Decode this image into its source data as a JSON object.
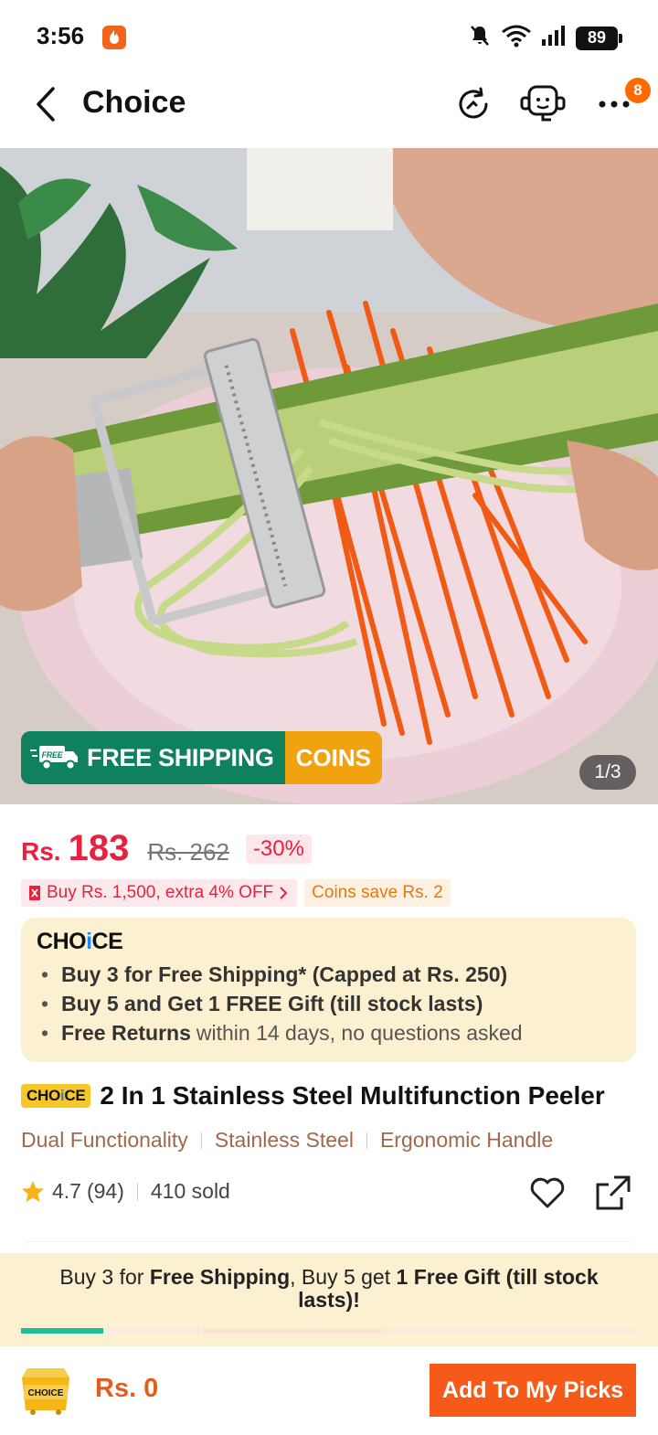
{
  "status_bar": {
    "time": "3:56",
    "battery": "89",
    "icons": [
      "bell-muted-icon",
      "wifi-icon",
      "signal-icon",
      "battery-icon"
    ]
  },
  "header": {
    "title": "Choice",
    "more_badge": "8",
    "icons": [
      "back-icon",
      "history-icon",
      "support-icon",
      "more-icon"
    ]
  },
  "gallery": {
    "shipping_banner": {
      "free_badge": "FREE",
      "label": "FREE SHIPPING",
      "coins_label": "COINS"
    },
    "counter": "1/3"
  },
  "price": {
    "currency": "Rs.",
    "current": "183",
    "original": "Rs. 262",
    "discount": "-30%",
    "accent_color": "#e8213f"
  },
  "promos": {
    "bundle_offer": "Buy Rs. 1,500, extra 4% OFF",
    "coins_save": "Coins save Rs. 2"
  },
  "choice_box": {
    "logo_prefix": "C",
    "logo_h": "H",
    "logo_o": "O",
    "logo_i": "i",
    "logo_ce": "CE",
    "items": [
      {
        "strong": "Buy 3 for  Free Shipping* (Capped at Rs. 250)",
        "muted": ""
      },
      {
        "strong": "Buy 5 and Get 1 FREE Gift (till stock lasts)",
        "muted": ""
      },
      {
        "strong": "Free Returns",
        "muted": "within 14 days, no questions asked"
      }
    ]
  },
  "product": {
    "badge_prefix": "C",
    "badge_h": "H",
    "badge_o": "O",
    "badge_i": "i",
    "badge_ce": "CE",
    "title": "2 In 1 Stainless Steel Multifunction Peeler",
    "features": [
      "Dual Functionality",
      "Stainless Steel",
      "Ergonomic Handle"
    ],
    "rating": "4.7",
    "reviews": "(94)",
    "sold": "410 sold"
  },
  "bottom_promo": {
    "part1": "Buy 3 for ",
    "bold1": "Free Shipping",
    "part2": ", Buy 5 get ",
    "bold2": "1 Free Gift (till stock lasts)!",
    "progress_fraction": 0.2,
    "progress_color": "#1dbf9a"
  },
  "bottom_bar": {
    "cart_label": "CHOICE",
    "total": "Rs. 0",
    "add_button": "Add To My Picks",
    "button_color": "#f55a18"
  }
}
